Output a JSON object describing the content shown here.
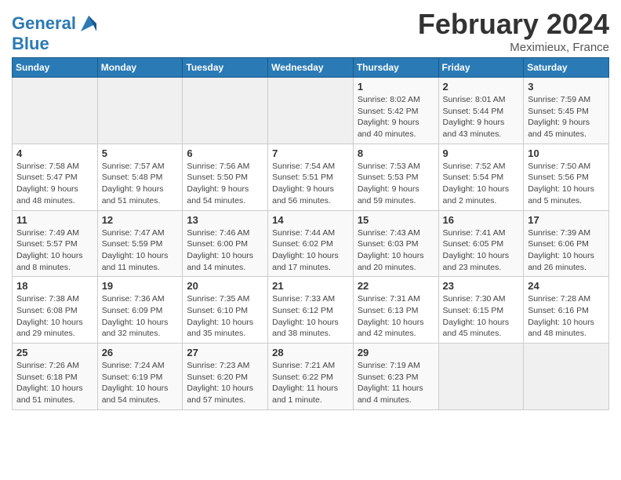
{
  "header": {
    "logo_line1": "General",
    "logo_line2": "Blue",
    "title": "February 2024",
    "location": "Meximieux, France"
  },
  "columns": [
    "Sunday",
    "Monday",
    "Tuesday",
    "Wednesday",
    "Thursday",
    "Friday",
    "Saturday"
  ],
  "weeks": [
    [
      {
        "day": "",
        "info": ""
      },
      {
        "day": "",
        "info": ""
      },
      {
        "day": "",
        "info": ""
      },
      {
        "day": "",
        "info": ""
      },
      {
        "day": "1",
        "info": "Sunrise: 8:02 AM\nSunset: 5:42 PM\nDaylight: 9 hours\nand 40 minutes."
      },
      {
        "day": "2",
        "info": "Sunrise: 8:01 AM\nSunset: 5:44 PM\nDaylight: 9 hours\nand 43 minutes."
      },
      {
        "day": "3",
        "info": "Sunrise: 7:59 AM\nSunset: 5:45 PM\nDaylight: 9 hours\nand 45 minutes."
      }
    ],
    [
      {
        "day": "4",
        "info": "Sunrise: 7:58 AM\nSunset: 5:47 PM\nDaylight: 9 hours\nand 48 minutes."
      },
      {
        "day": "5",
        "info": "Sunrise: 7:57 AM\nSunset: 5:48 PM\nDaylight: 9 hours\nand 51 minutes."
      },
      {
        "day": "6",
        "info": "Sunrise: 7:56 AM\nSunset: 5:50 PM\nDaylight: 9 hours\nand 54 minutes."
      },
      {
        "day": "7",
        "info": "Sunrise: 7:54 AM\nSunset: 5:51 PM\nDaylight: 9 hours\nand 56 minutes."
      },
      {
        "day": "8",
        "info": "Sunrise: 7:53 AM\nSunset: 5:53 PM\nDaylight: 9 hours\nand 59 minutes."
      },
      {
        "day": "9",
        "info": "Sunrise: 7:52 AM\nSunset: 5:54 PM\nDaylight: 10 hours\nand 2 minutes."
      },
      {
        "day": "10",
        "info": "Sunrise: 7:50 AM\nSunset: 5:56 PM\nDaylight: 10 hours\nand 5 minutes."
      }
    ],
    [
      {
        "day": "11",
        "info": "Sunrise: 7:49 AM\nSunset: 5:57 PM\nDaylight: 10 hours\nand 8 minutes."
      },
      {
        "day": "12",
        "info": "Sunrise: 7:47 AM\nSunset: 5:59 PM\nDaylight: 10 hours\nand 11 minutes."
      },
      {
        "day": "13",
        "info": "Sunrise: 7:46 AM\nSunset: 6:00 PM\nDaylight: 10 hours\nand 14 minutes."
      },
      {
        "day": "14",
        "info": "Sunrise: 7:44 AM\nSunset: 6:02 PM\nDaylight: 10 hours\nand 17 minutes."
      },
      {
        "day": "15",
        "info": "Sunrise: 7:43 AM\nSunset: 6:03 PM\nDaylight: 10 hours\nand 20 minutes."
      },
      {
        "day": "16",
        "info": "Sunrise: 7:41 AM\nSunset: 6:05 PM\nDaylight: 10 hours\nand 23 minutes."
      },
      {
        "day": "17",
        "info": "Sunrise: 7:39 AM\nSunset: 6:06 PM\nDaylight: 10 hours\nand 26 minutes."
      }
    ],
    [
      {
        "day": "18",
        "info": "Sunrise: 7:38 AM\nSunset: 6:08 PM\nDaylight: 10 hours\nand 29 minutes."
      },
      {
        "day": "19",
        "info": "Sunrise: 7:36 AM\nSunset: 6:09 PM\nDaylight: 10 hours\nand 32 minutes."
      },
      {
        "day": "20",
        "info": "Sunrise: 7:35 AM\nSunset: 6:10 PM\nDaylight: 10 hours\nand 35 minutes."
      },
      {
        "day": "21",
        "info": "Sunrise: 7:33 AM\nSunset: 6:12 PM\nDaylight: 10 hours\nand 38 minutes."
      },
      {
        "day": "22",
        "info": "Sunrise: 7:31 AM\nSunset: 6:13 PM\nDaylight: 10 hours\nand 42 minutes."
      },
      {
        "day": "23",
        "info": "Sunrise: 7:30 AM\nSunset: 6:15 PM\nDaylight: 10 hours\nand 45 minutes."
      },
      {
        "day": "24",
        "info": "Sunrise: 7:28 AM\nSunset: 6:16 PM\nDaylight: 10 hours\nand 48 minutes."
      }
    ],
    [
      {
        "day": "25",
        "info": "Sunrise: 7:26 AM\nSunset: 6:18 PM\nDaylight: 10 hours\nand 51 minutes."
      },
      {
        "day": "26",
        "info": "Sunrise: 7:24 AM\nSunset: 6:19 PM\nDaylight: 10 hours\nand 54 minutes."
      },
      {
        "day": "27",
        "info": "Sunrise: 7:23 AM\nSunset: 6:20 PM\nDaylight: 10 hours\nand 57 minutes."
      },
      {
        "day": "28",
        "info": "Sunrise: 7:21 AM\nSunset: 6:22 PM\nDaylight: 11 hours\nand 1 minute."
      },
      {
        "day": "29",
        "info": "Sunrise: 7:19 AM\nSunset: 6:23 PM\nDaylight: 11 hours\nand 4 minutes."
      },
      {
        "day": "",
        "info": ""
      },
      {
        "day": "",
        "info": ""
      }
    ]
  ]
}
